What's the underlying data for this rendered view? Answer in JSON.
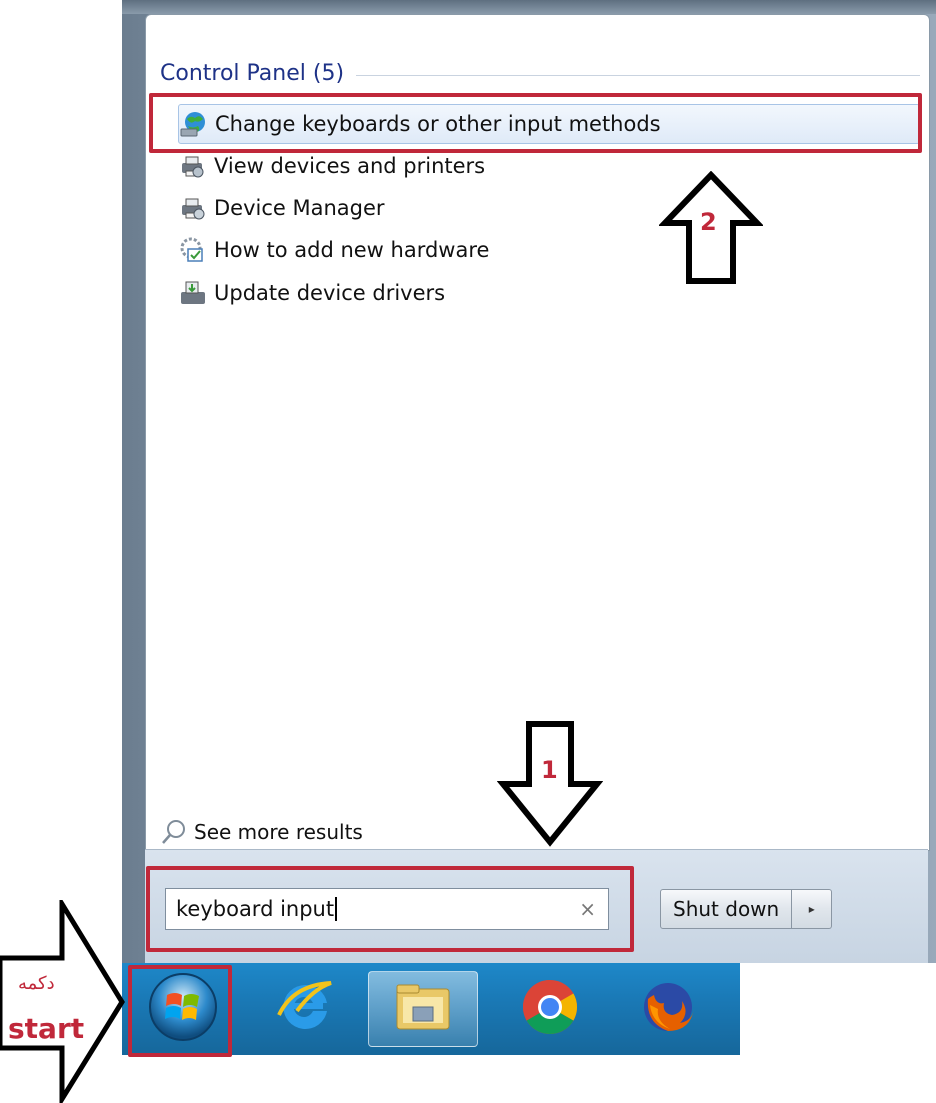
{
  "start_menu": {
    "section_header": "Control Panel (5)",
    "results": [
      {
        "label": "Change keyboards or other input methods",
        "icon": "globe-keyboard-icon",
        "selected": true
      },
      {
        "label": "View devices and printers",
        "icon": "devices-printers-icon"
      },
      {
        "label": "Device Manager",
        "icon": "device-manager-icon"
      },
      {
        "label": "How to add new hardware",
        "icon": "hardware-wizard-icon"
      },
      {
        "label": "Update device drivers",
        "icon": "driver-update-icon"
      }
    ],
    "see_more": "See more results",
    "search": {
      "value": "keyboard input",
      "clear": "×"
    },
    "shutdown": {
      "label": "Shut down",
      "arrow": "▸"
    }
  },
  "taskbar": {
    "items": [
      {
        "name": "start-orb-icon"
      },
      {
        "name": "internet-explorer-icon"
      },
      {
        "name": "file-explorer-icon",
        "active": true
      },
      {
        "name": "chrome-icon"
      },
      {
        "name": "firefox-icon"
      }
    ]
  },
  "annotations": {
    "step1": "1",
    "step2": "2",
    "start_persian": "دکمه",
    "start_english": "start",
    "highlight_color": "#c0283a"
  }
}
